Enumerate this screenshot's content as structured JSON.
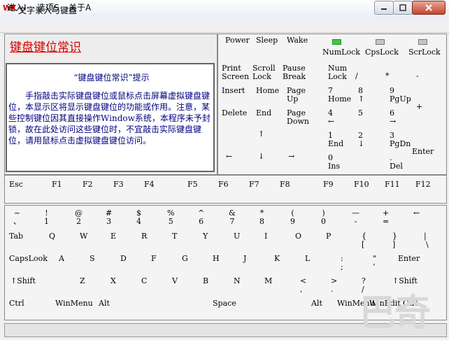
{
  "app": {
    "icon_text": "WK",
    "title": "文字录入与键盘",
    "min_label": "▭",
    "max_label": "▢",
    "close_label": "✕"
  },
  "menu": [
    "进入I",
    "选项S",
    "关于A"
  ],
  "info": {
    "heading": "键盘键位常识",
    "note_title": "“键盘键位常识”提示",
    "note_body": "手指敲击实际键盘键位或鼠标点击屏幕虚拟键盘键位，本显示区将显示键盘键位的功能或作用。注意，某些控制键位因其直接操作Window系统，本程序未予封锁，故在此处访问这些键位时，不宜敲击实际键盘键位，请用鼠标点击虚拟键盘键位访问。"
  },
  "power": {
    "power": "Power",
    "sleep": "Sleep",
    "wake": "Wake"
  },
  "leds": {
    "num": "NumLock",
    "caps": "CpsLock",
    "scroll": "ScrLock",
    "num_on": true,
    "caps_on": false,
    "scroll_on": false
  },
  "nav": {
    "print1": "Print",
    "print2": "Screen",
    "scroll1": "Scroll",
    "scroll2": "Lock",
    "pause1": "Pause",
    "pause2": "Break",
    "insert": "Insert",
    "home": "Home",
    "pageup1": "Page",
    "pageup2": "Up",
    "delete": "Delete",
    "end": "End",
    "pagedown1": "Page",
    "pagedown2": "Down",
    "up": "↑",
    "left": "←",
    "down": "↓",
    "right": "→"
  },
  "numpad": {
    "numlock1": "Num",
    "numlock2": "Lock",
    "slash": "/",
    "star": "*",
    "minus": "-",
    "n7": "7",
    "n7b": "Home",
    "n8": "8",
    "n8b": "↑",
    "n9": "9",
    "n9b": "PgUp",
    "plus": "+",
    "n4": "4",
    "n4b": "←",
    "n5": "5",
    "n6": "6",
    "n6b": "→",
    "n1": "1",
    "n1b": "End",
    "n2": "2",
    "n2b": "↓",
    "n3": "3",
    "n3b": "PgDn",
    "enter": "Enter",
    "n0": "0",
    "n0b": "Ins",
    "dot": ".",
    "dotb": "Del"
  },
  "fkeys": [
    "Esc",
    "F1",
    "F2",
    "F3",
    "F4",
    "F5",
    "F6",
    "F7",
    "F8",
    "F9",
    "F10",
    "F11",
    "F12"
  ],
  "row1": [
    {
      "top": "~",
      "bottom": "、"
    },
    {
      "top": "!",
      "bottom": "1"
    },
    {
      "top": "@",
      "bottom": "2"
    },
    {
      "top": "#",
      "bottom": "3"
    },
    {
      "top": "$",
      "bottom": "4"
    },
    {
      "top": "%",
      "bottom": "5"
    },
    {
      "top": "^",
      "bottom": "6"
    },
    {
      "top": "&",
      "bottom": "7"
    },
    {
      "top": "*",
      "bottom": "8"
    },
    {
      "top": "(",
      "bottom": "9"
    },
    {
      "top": ")",
      "bottom": "0"
    },
    {
      "top": "—",
      "bottom": "-"
    },
    {
      "top": "+",
      "bottom": "="
    },
    {
      "top": "←",
      "bottom": ""
    }
  ],
  "row2": [
    "Tab",
    "Q",
    "W",
    "E",
    "R",
    "T",
    "Y",
    "U",
    "I",
    "O",
    "P"
  ],
  "row2_brackets": [
    {
      "top": "{",
      "bottom": "["
    },
    {
      "top": "}",
      "bottom": "]"
    },
    {
      "top": "|",
      "bottom": "\\"
    }
  ],
  "row3": [
    "CapsLook",
    "A",
    "S",
    "D",
    "F",
    "G",
    "H",
    "J",
    "K",
    "L"
  ],
  "row3_punct": [
    {
      "top": ":",
      "bottom": ";"
    },
    {
      "top": "\"",
      "bottom": "’"
    }
  ],
  "row3_enter": "Enter",
  "row4": [
    "↑Shift",
    "Z",
    "X",
    "C",
    "V",
    "B",
    "N",
    "M"
  ],
  "row4_punct": [
    {
      "top": "<",
      "bottom": ","
    },
    {
      "top": ">",
      "bottom": "."
    },
    {
      "top": "?",
      "bottom": "/"
    }
  ],
  "row4_rshift": "↑Shift",
  "row5": [
    "Ctrl",
    "WinMenu",
    "Alt",
    "Space",
    "Alt",
    "WinMenu",
    "WinEdit",
    "Ctrl"
  ],
  "watermark": "巴奇"
}
